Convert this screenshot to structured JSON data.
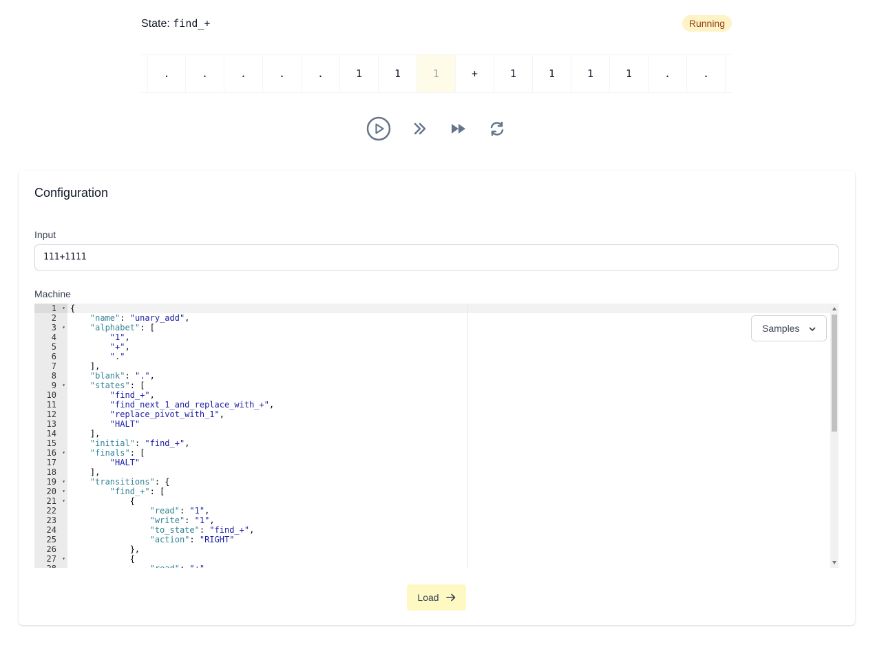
{
  "header": {
    "state_label": "State:",
    "state_value": "find_+",
    "status": "Running"
  },
  "tape": {
    "cells": [
      ".",
      ".",
      ".",
      ".",
      ".",
      "1",
      "1",
      "1",
      "+",
      "1",
      "1",
      "1",
      "1",
      ".",
      "."
    ],
    "head_index": 7
  },
  "controls": {
    "icons": [
      "play-circle-icon",
      "chevrons-right-icon",
      "fast-forward-icon",
      "refresh-icon"
    ]
  },
  "config": {
    "title": "Configuration",
    "input_label": "Input",
    "input_value": "111+1111",
    "machine_label": "Machine",
    "samples_label": "Samples",
    "load_label": "Load"
  },
  "editor": {
    "lines": [
      "{",
      "    \"name\": \"unary_add\",",
      "    \"alphabet\": [",
      "        \"1\",",
      "        \"+\",",
      "        \".\"",
      "    ],",
      "    \"blank\": \".\",",
      "    \"states\": [",
      "        \"find_+\",",
      "        \"find_next_1_and_replace_with_+\",",
      "        \"replace_pivot_with_1\",",
      "        \"HALT\"",
      "    ],",
      "    \"initial\": \"find_+\",",
      "    \"finals\": [",
      "        \"HALT\"",
      "    ],",
      "    \"transitions\": {",
      "        \"find_+\": [",
      "            {",
      "                \"read\": \"1\",",
      "                \"write\": \"1\",",
      "                \"to_state\": \"find_+\",",
      "                \"action\": \"RIGHT\"",
      "            },",
      "            {",
      "                \"read\": \"+\","
    ],
    "fold_lines": [
      1,
      3,
      9,
      16,
      19,
      20,
      21,
      27
    ]
  },
  "colors": {
    "head_cell_bg": "#fefce8",
    "badge_bg": "#fef3c7",
    "badge_text": "#92400e",
    "load_bg": "#fef9c3",
    "control_icon": "#64748b"
  }
}
